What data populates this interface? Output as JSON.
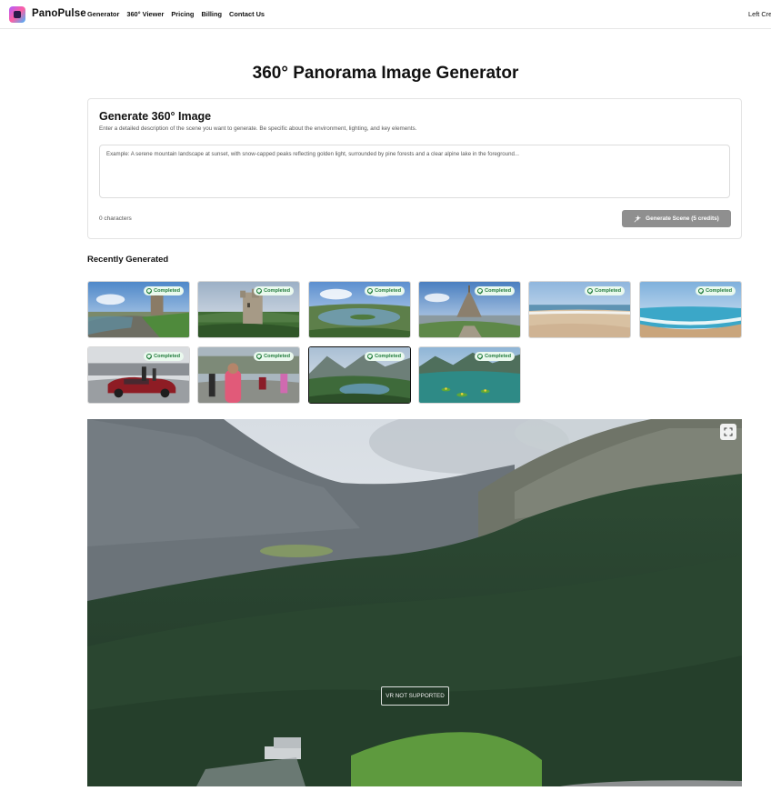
{
  "nav": {
    "brand": "PanoPulse",
    "links": [
      "Generator",
      "360° Viewer",
      "Pricing",
      "Billing",
      "Contact Us"
    ],
    "right_text": "Left Credits"
  },
  "page_title": "360° Panorama Image Generator",
  "generator": {
    "title": "Generate 360° Image",
    "subtitle": "Enter a detailed description of the scene you want to generate. Be specific about the environment, lighting, and key elements.",
    "prompt_placeholder": "Example: A serene mountain landscape at sunset, with snow-capped peaks reflecting golden light, surrounded by pine forests and a clear alpine lake in the foreground...",
    "prompt_value": "",
    "char_count": "0 characters",
    "button_label": "Generate Scene (5 credits)"
  },
  "recent": {
    "title": "Recently Generated",
    "status_label": "Completed",
    "items": [
      {
        "scene": "castle-plaza",
        "status": "Completed",
        "selected": false
      },
      {
        "scene": "castle-tower",
        "status": "Completed",
        "selected": false
      },
      {
        "scene": "lake-aerial",
        "status": "Completed",
        "selected": false
      },
      {
        "scene": "island-abbey",
        "status": "Completed",
        "selected": false
      },
      {
        "scene": "beach-sand",
        "status": "Completed",
        "selected": false
      },
      {
        "scene": "beach-sea",
        "status": "Completed",
        "selected": false
      },
      {
        "scene": "car-street",
        "status": "Completed",
        "selected": false
      },
      {
        "scene": "people-selfie",
        "status": "Completed",
        "selected": false
      },
      {
        "scene": "mountain-lake",
        "status": "Completed",
        "selected": true
      },
      {
        "scene": "lily-lake",
        "status": "Completed",
        "selected": false
      }
    ]
  },
  "viewer": {
    "vr_label": "VR NOT SUPPORTED",
    "fullscreen_icon": "fullscreen-icon"
  },
  "colors": {
    "button_disabled": "#8f8f8f",
    "badge_bg": "#eaf9ee",
    "badge_text": "#1f7a3a"
  }
}
